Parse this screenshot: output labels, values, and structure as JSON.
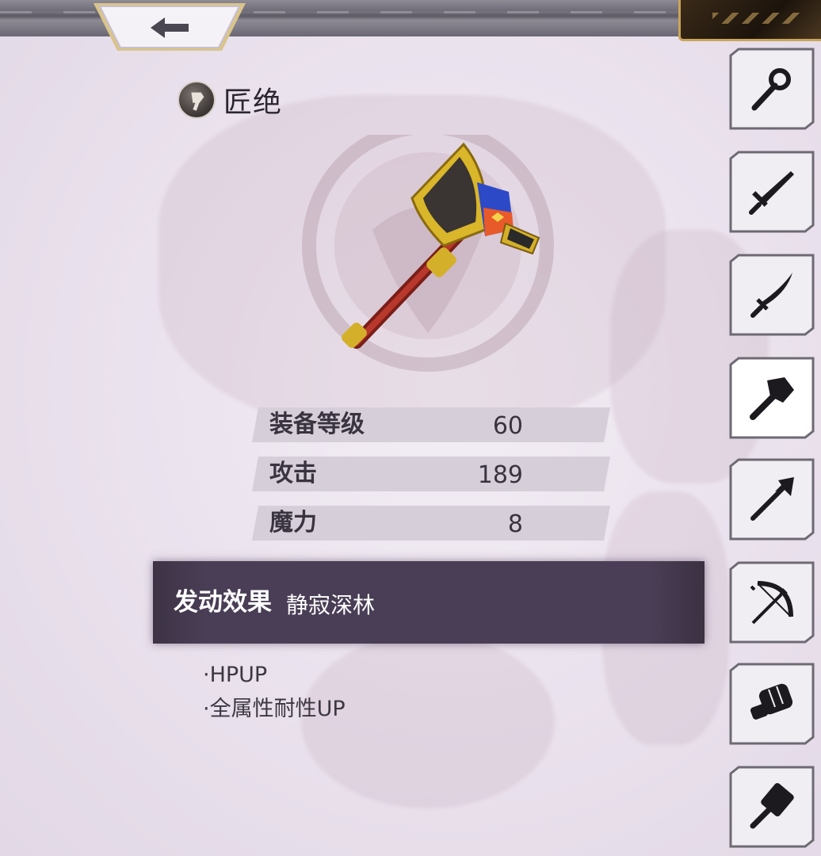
{
  "header": {
    "back_icon": "left-arrow-icon",
    "accent": "#d9c48a"
  },
  "item": {
    "type_icon": "axe-icon",
    "name": "匠绝"
  },
  "stats": [
    {
      "label": "装备等级",
      "value": "60"
    },
    {
      "label": "攻击",
      "value": "189"
    },
    {
      "label": "魔力",
      "value": "8"
    }
  ],
  "skill": {
    "title": "发动效果",
    "name": "静寂深林",
    "effects": [
      "·HPUP",
      "·全属性耐性UP"
    ]
  },
  "weapon_tabs": [
    {
      "icon": "staff-icon",
      "active": false
    },
    {
      "icon": "sword-icon",
      "active": false
    },
    {
      "icon": "saber-icon",
      "active": false
    },
    {
      "icon": "axe-icon",
      "active": true
    },
    {
      "icon": "spear-icon",
      "active": false
    },
    {
      "icon": "bow-icon",
      "active": false
    },
    {
      "icon": "fist-icon",
      "active": false
    },
    {
      "icon": "hammer-icon",
      "active": false
    }
  ],
  "colors": {
    "banner": "#4a3e56",
    "text_dark": "#3a3440",
    "stat_row": "#d6cfd9"
  }
}
